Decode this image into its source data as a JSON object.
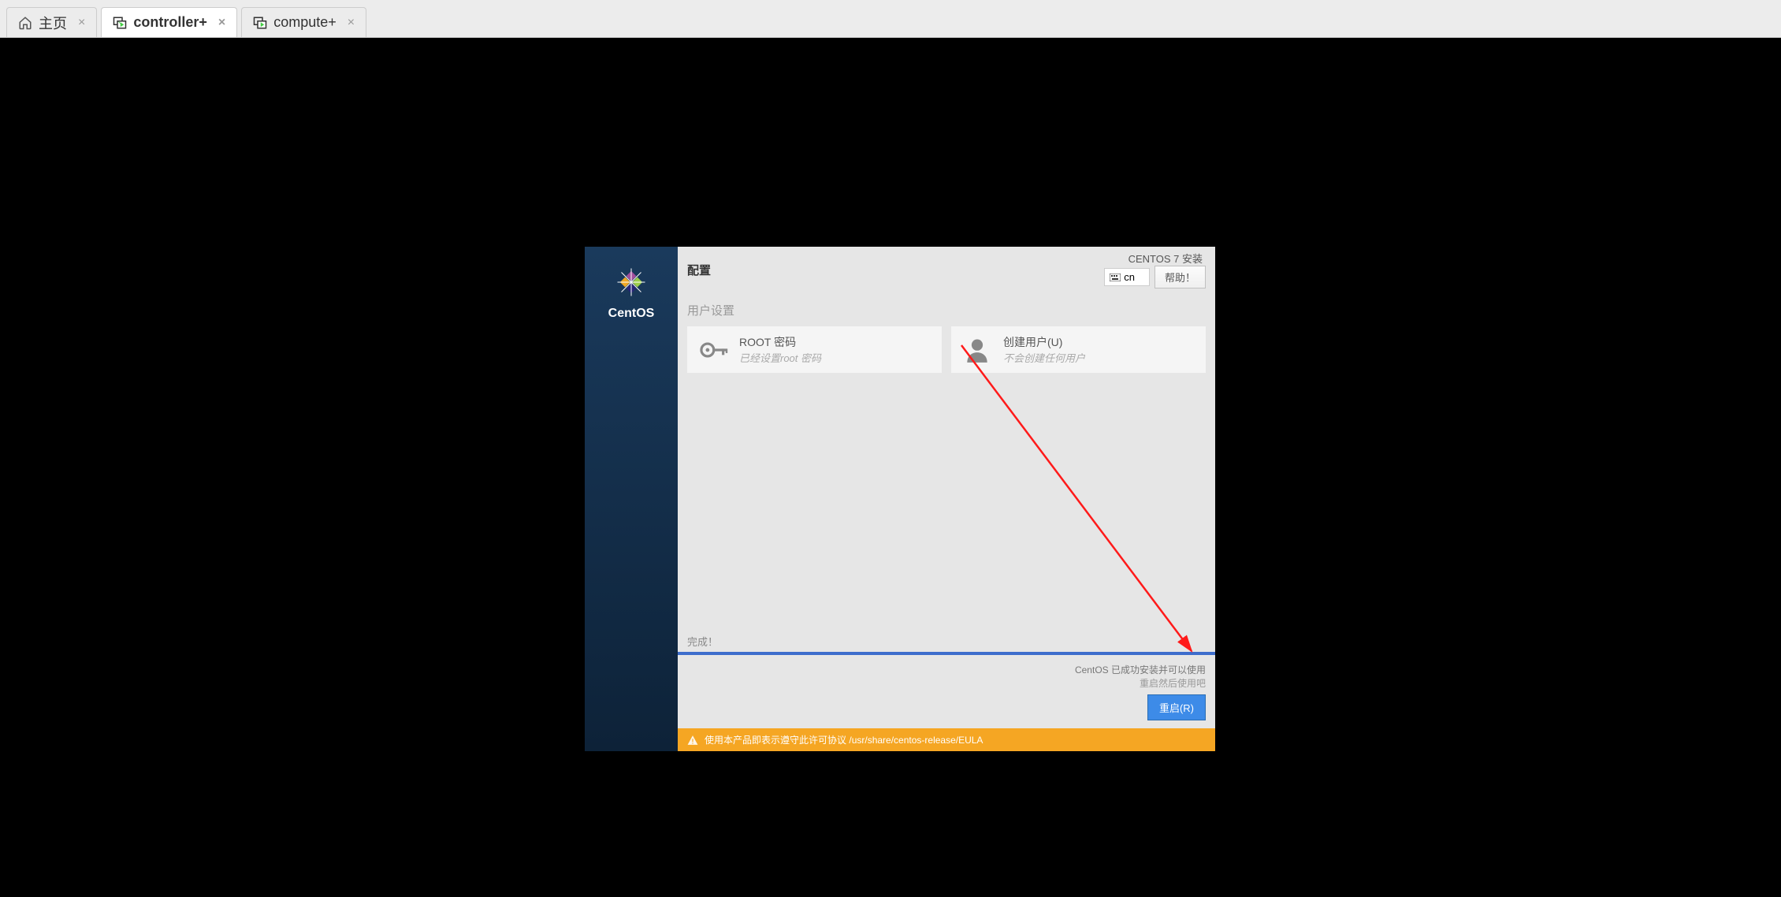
{
  "tabs": [
    {
      "label": "主页",
      "active": false
    },
    {
      "label": "controller+",
      "active": true
    },
    {
      "label": "compute+",
      "active": false
    }
  ],
  "installer": {
    "brand": "CentOS",
    "header": {
      "config_title": "配置",
      "install_title": "CENTOS 7 安装",
      "lang_code": "cn",
      "help_label": "帮助！"
    },
    "user_settings": {
      "section_title": "用户设置",
      "root": {
        "title": "ROOT 密码",
        "subtitle": "已经设置root 密码"
      },
      "create_user": {
        "title": "创建用户(U)",
        "subtitle": "不会创建任何用户"
      }
    },
    "progress": {
      "complete_label": "完成！",
      "status1": "CentOS 已成功安装并可以使用",
      "status2": "重启然后使用吧",
      "reboot_label": "重启(R)"
    },
    "eula": {
      "text_prefix": "使用本产品即表示遵守此许可协议",
      "path": "/usr/share/centos-release/EULA"
    }
  }
}
